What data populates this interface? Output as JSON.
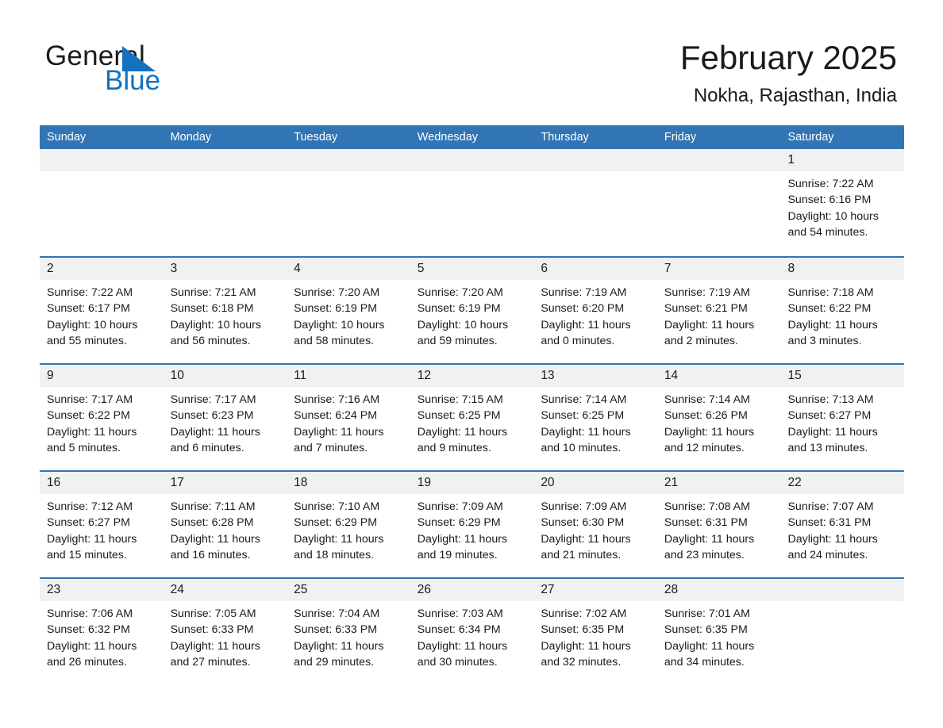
{
  "brand": {
    "word_general": "General",
    "word_blue": "Blue",
    "triangle_color": "#1272c0"
  },
  "header": {
    "title": "February 2025",
    "location": "Nokha, Rajasthan, India"
  },
  "colors": {
    "header_blue": "#3275b4",
    "day_band_gray": "#f1f1f1",
    "text": "#1a1a1a",
    "header_text": "#ffffff"
  },
  "weekdays": [
    "Sunday",
    "Monday",
    "Tuesday",
    "Wednesday",
    "Thursday",
    "Friday",
    "Saturday"
  ],
  "weeks": [
    [
      {
        "day": "",
        "sunrise": "",
        "sunset": "",
        "daylight_1": "",
        "daylight_2": ""
      },
      {
        "day": "",
        "sunrise": "",
        "sunset": "",
        "daylight_1": "",
        "daylight_2": ""
      },
      {
        "day": "",
        "sunrise": "",
        "sunset": "",
        "daylight_1": "",
        "daylight_2": ""
      },
      {
        "day": "",
        "sunrise": "",
        "sunset": "",
        "daylight_1": "",
        "daylight_2": ""
      },
      {
        "day": "",
        "sunrise": "",
        "sunset": "",
        "daylight_1": "",
        "daylight_2": ""
      },
      {
        "day": "",
        "sunrise": "",
        "sunset": "",
        "daylight_1": "",
        "daylight_2": ""
      },
      {
        "day": "1",
        "sunrise": "Sunrise: 7:22 AM",
        "sunset": "Sunset: 6:16 PM",
        "daylight_1": "Daylight: 10 hours",
        "daylight_2": "and 54 minutes."
      }
    ],
    [
      {
        "day": "2",
        "sunrise": "Sunrise: 7:22 AM",
        "sunset": "Sunset: 6:17 PM",
        "daylight_1": "Daylight: 10 hours",
        "daylight_2": "and 55 minutes."
      },
      {
        "day": "3",
        "sunrise": "Sunrise: 7:21 AM",
        "sunset": "Sunset: 6:18 PM",
        "daylight_1": "Daylight: 10 hours",
        "daylight_2": "and 56 minutes."
      },
      {
        "day": "4",
        "sunrise": "Sunrise: 7:20 AM",
        "sunset": "Sunset: 6:19 PM",
        "daylight_1": "Daylight: 10 hours",
        "daylight_2": "and 58 minutes."
      },
      {
        "day": "5",
        "sunrise": "Sunrise: 7:20 AM",
        "sunset": "Sunset: 6:19 PM",
        "daylight_1": "Daylight: 10 hours",
        "daylight_2": "and 59 minutes."
      },
      {
        "day": "6",
        "sunrise": "Sunrise: 7:19 AM",
        "sunset": "Sunset: 6:20 PM",
        "daylight_1": "Daylight: 11 hours",
        "daylight_2": "and 0 minutes."
      },
      {
        "day": "7",
        "sunrise": "Sunrise: 7:19 AM",
        "sunset": "Sunset: 6:21 PM",
        "daylight_1": "Daylight: 11 hours",
        "daylight_2": "and 2 minutes."
      },
      {
        "day": "8",
        "sunrise": "Sunrise: 7:18 AM",
        "sunset": "Sunset: 6:22 PM",
        "daylight_1": "Daylight: 11 hours",
        "daylight_2": "and 3 minutes."
      }
    ],
    [
      {
        "day": "9",
        "sunrise": "Sunrise: 7:17 AM",
        "sunset": "Sunset: 6:22 PM",
        "daylight_1": "Daylight: 11 hours",
        "daylight_2": "and 5 minutes."
      },
      {
        "day": "10",
        "sunrise": "Sunrise: 7:17 AM",
        "sunset": "Sunset: 6:23 PM",
        "daylight_1": "Daylight: 11 hours",
        "daylight_2": "and 6 minutes."
      },
      {
        "day": "11",
        "sunrise": "Sunrise: 7:16 AM",
        "sunset": "Sunset: 6:24 PM",
        "daylight_1": "Daylight: 11 hours",
        "daylight_2": "and 7 minutes."
      },
      {
        "day": "12",
        "sunrise": "Sunrise: 7:15 AM",
        "sunset": "Sunset: 6:25 PM",
        "daylight_1": "Daylight: 11 hours",
        "daylight_2": "and 9 minutes."
      },
      {
        "day": "13",
        "sunrise": "Sunrise: 7:14 AM",
        "sunset": "Sunset: 6:25 PM",
        "daylight_1": "Daylight: 11 hours",
        "daylight_2": "and 10 minutes."
      },
      {
        "day": "14",
        "sunrise": "Sunrise: 7:14 AM",
        "sunset": "Sunset: 6:26 PM",
        "daylight_1": "Daylight: 11 hours",
        "daylight_2": "and 12 minutes."
      },
      {
        "day": "15",
        "sunrise": "Sunrise: 7:13 AM",
        "sunset": "Sunset: 6:27 PM",
        "daylight_1": "Daylight: 11 hours",
        "daylight_2": "and 13 minutes."
      }
    ],
    [
      {
        "day": "16",
        "sunrise": "Sunrise: 7:12 AM",
        "sunset": "Sunset: 6:27 PM",
        "daylight_1": "Daylight: 11 hours",
        "daylight_2": "and 15 minutes."
      },
      {
        "day": "17",
        "sunrise": "Sunrise: 7:11 AM",
        "sunset": "Sunset: 6:28 PM",
        "daylight_1": "Daylight: 11 hours",
        "daylight_2": "and 16 minutes."
      },
      {
        "day": "18",
        "sunrise": "Sunrise: 7:10 AM",
        "sunset": "Sunset: 6:29 PM",
        "daylight_1": "Daylight: 11 hours",
        "daylight_2": "and 18 minutes."
      },
      {
        "day": "19",
        "sunrise": "Sunrise: 7:09 AM",
        "sunset": "Sunset: 6:29 PM",
        "daylight_1": "Daylight: 11 hours",
        "daylight_2": "and 19 minutes."
      },
      {
        "day": "20",
        "sunrise": "Sunrise: 7:09 AM",
        "sunset": "Sunset: 6:30 PM",
        "daylight_1": "Daylight: 11 hours",
        "daylight_2": "and 21 minutes."
      },
      {
        "day": "21",
        "sunrise": "Sunrise: 7:08 AM",
        "sunset": "Sunset: 6:31 PM",
        "daylight_1": "Daylight: 11 hours",
        "daylight_2": "and 23 minutes."
      },
      {
        "day": "22",
        "sunrise": "Sunrise: 7:07 AM",
        "sunset": "Sunset: 6:31 PM",
        "daylight_1": "Daylight: 11 hours",
        "daylight_2": "and 24 minutes."
      }
    ],
    [
      {
        "day": "23",
        "sunrise": "Sunrise: 7:06 AM",
        "sunset": "Sunset: 6:32 PM",
        "daylight_1": "Daylight: 11 hours",
        "daylight_2": "and 26 minutes."
      },
      {
        "day": "24",
        "sunrise": "Sunrise: 7:05 AM",
        "sunset": "Sunset: 6:33 PM",
        "daylight_1": "Daylight: 11 hours",
        "daylight_2": "and 27 minutes."
      },
      {
        "day": "25",
        "sunrise": "Sunrise: 7:04 AM",
        "sunset": "Sunset: 6:33 PM",
        "daylight_1": "Daylight: 11 hours",
        "daylight_2": "and 29 minutes."
      },
      {
        "day": "26",
        "sunrise": "Sunrise: 7:03 AM",
        "sunset": "Sunset: 6:34 PM",
        "daylight_1": "Daylight: 11 hours",
        "daylight_2": "and 30 minutes."
      },
      {
        "day": "27",
        "sunrise": "Sunrise: 7:02 AM",
        "sunset": "Sunset: 6:35 PM",
        "daylight_1": "Daylight: 11 hours",
        "daylight_2": "and 32 minutes."
      },
      {
        "day": "28",
        "sunrise": "Sunrise: 7:01 AM",
        "sunset": "Sunset: 6:35 PM",
        "daylight_1": "Daylight: 11 hours",
        "daylight_2": "and 34 minutes."
      },
      {
        "day": "",
        "sunrise": "",
        "sunset": "",
        "daylight_1": "",
        "daylight_2": ""
      }
    ]
  ]
}
